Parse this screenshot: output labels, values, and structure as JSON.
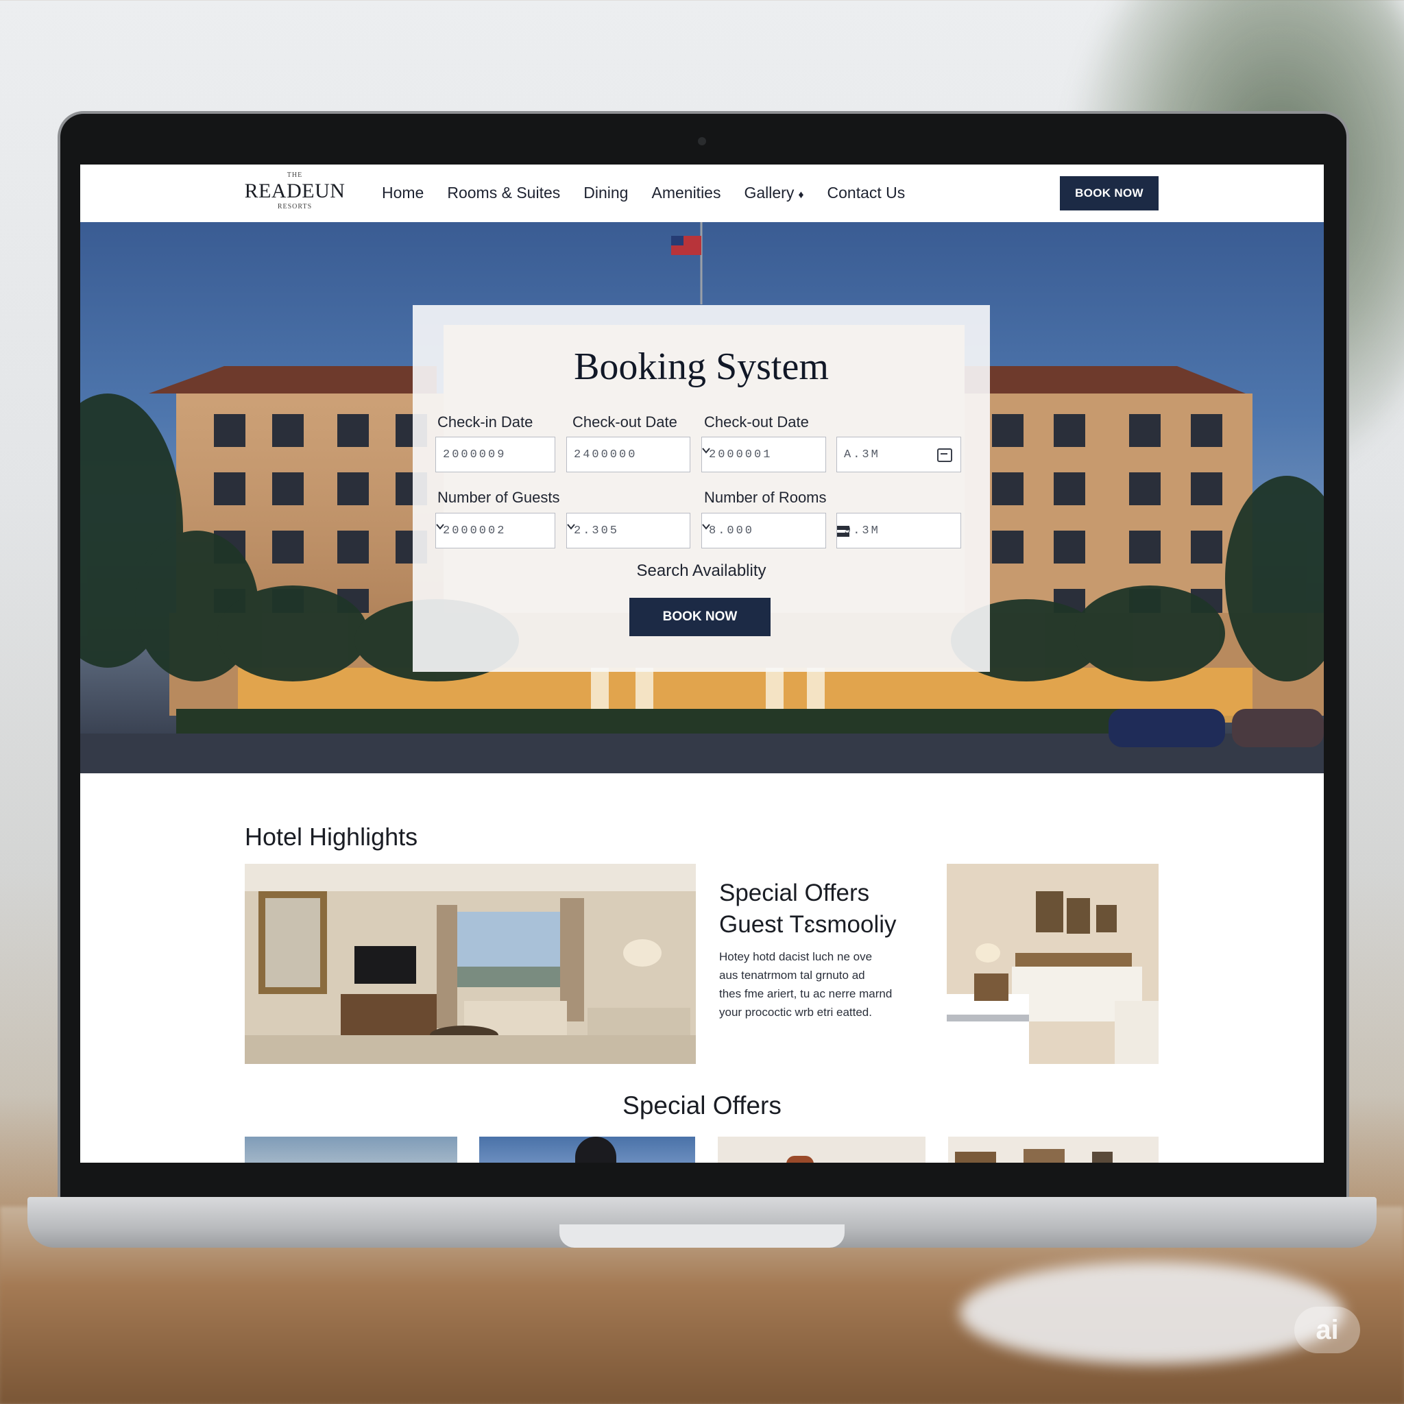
{
  "logo": {
    "small_top": "THE",
    "name": "READEUN",
    "small_bottom": "RESORTS"
  },
  "nav": {
    "links": [
      {
        "label": "Home"
      },
      {
        "label": "Rooms & Suites"
      },
      {
        "label": "Dining"
      },
      {
        "label": "Amenities"
      },
      {
        "label": "Gallery"
      },
      {
        "label": "Contact Us"
      }
    ],
    "gallery_caret": "♦",
    "book_button": "BOOK NOW"
  },
  "booking": {
    "title": "Booking System",
    "checkin_label": "Check-in Date",
    "checkout_label": "Check-out Date",
    "checkout_label_2": "Check-out Date",
    "checkin_value": "2000009",
    "checkout_value": "2400000",
    "checkout_select_value": "2000001",
    "time_value": "A.3M",
    "guests_label": "Number of Guests",
    "rooms_label": "Number of Rooms",
    "guests_value": "2000002",
    "guests_select_2_value": "2.305",
    "rooms_value": "8.000",
    "rooms_time_value": "9.3M",
    "search_label": "Search Availablity",
    "book_button": "BOOK NOW"
  },
  "highlights": {
    "title": "Hotel Highlights",
    "offers_heading_1": "Special Offers",
    "offers_heading_2": "Guest Tɛsmooliy",
    "offers_body_lines": [
      "Hotey hotd dacist luch ne ove",
      "aus tenatrmom tal grnuto ad",
      "thes fme ariert, tu ac nerre marnd",
      "your prococtic wrb etri eatted."
    ]
  },
  "special_offers": {
    "title": "Special Offers"
  },
  "watermark": "ai",
  "colors": {
    "accent": "#1c2a45",
    "text": "#1a1d24",
    "field_border": "#b9bcc4"
  }
}
